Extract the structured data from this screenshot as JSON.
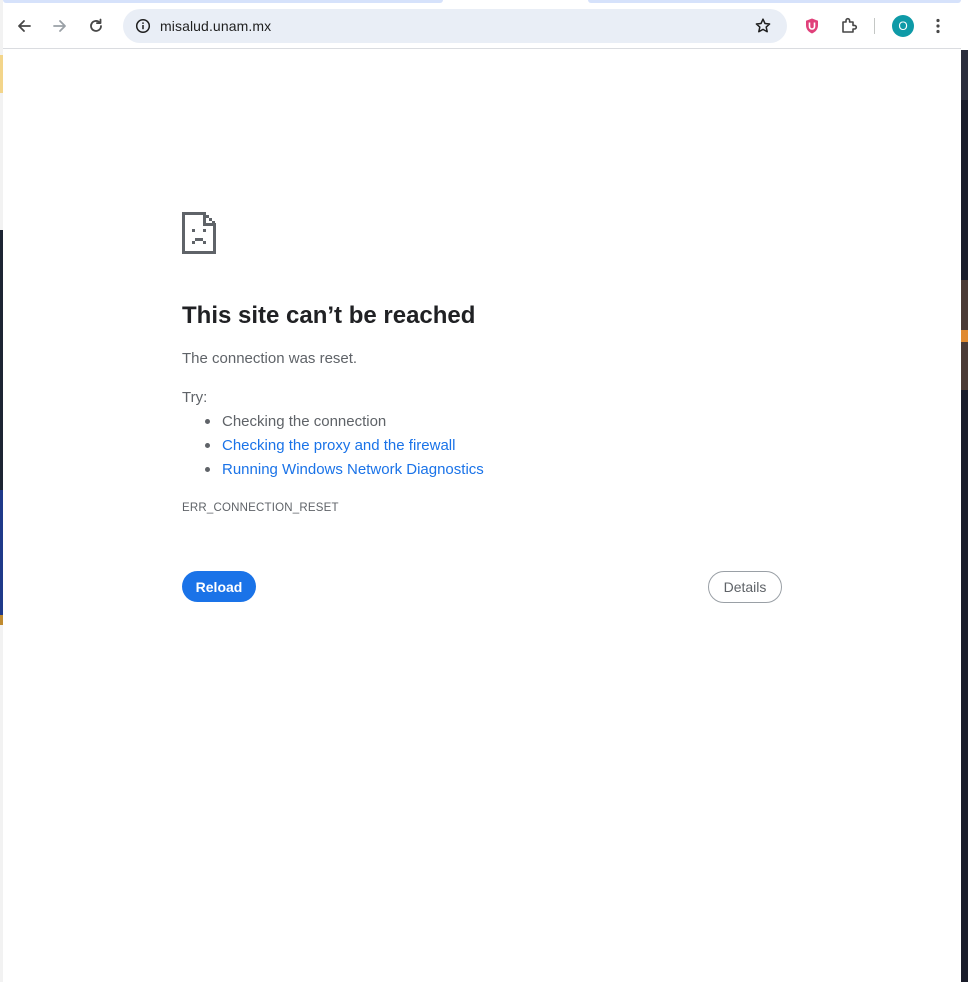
{
  "browser": {
    "url": "misalud.unam.mx",
    "profile_initial": "O",
    "icons": {
      "back": "arrow-left-icon",
      "forward": "arrow-right-icon",
      "reload": "reload-icon",
      "site_info": "info-icon",
      "bookmark": "star-icon",
      "extension_shield": "shield-extension-icon",
      "extensions": "puzzle-icon",
      "menu": "kebab-menu-icon"
    },
    "colors": {
      "omnibox_bg": "#e9eef6",
      "avatar_bg": "#0e9aa7",
      "shield_ext": "#e0407a"
    }
  },
  "error_page": {
    "title": "This site can’t be reached",
    "description": "The connection was reset.",
    "try_label": "Try:",
    "suggestions": [
      {
        "text": "Checking the connection",
        "link": false
      },
      {
        "text": "Checking the proxy and the firewall",
        "link": true
      },
      {
        "text": "Running Windows Network Diagnostics",
        "link": true
      }
    ],
    "error_code": "ERR_CONNECTION_RESET",
    "reload_label": "Reload",
    "details_label": "Details",
    "colors": {
      "primary_button": "#1a73e8",
      "link": "#1a73e8",
      "title": "#202124",
      "body_text": "#5f6368"
    }
  }
}
